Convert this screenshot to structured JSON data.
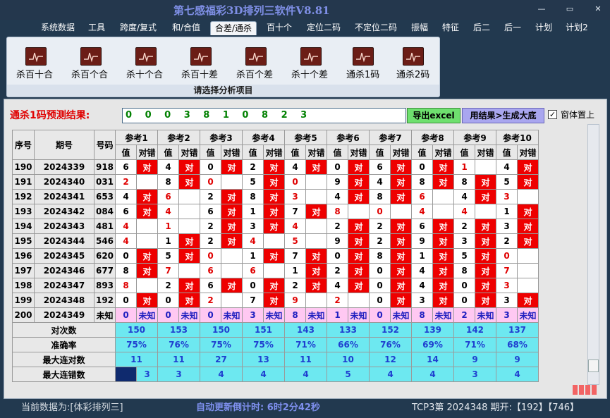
{
  "window": {
    "title": "第七感福彩3D排列三软件V8.81",
    "min": "—",
    "max": "▭",
    "close": "✕"
  },
  "menu": [
    "系统数据",
    "工具",
    "跨度/复式",
    "和/合值",
    "合差/通杀",
    "百十个",
    "定位二码",
    "不定位二码",
    "振幅",
    "特征",
    "后二",
    "后一",
    "计划",
    "计划2"
  ],
  "menu_active": "合差/通杀",
  "ribbon": {
    "items": [
      "杀百十合",
      "杀百个合",
      "杀十个合",
      "杀百十差",
      "杀百个差",
      "杀十个差",
      "通杀1码",
      "通杀2码"
    ],
    "footer": "请选择分析项目",
    "icon": "chart-icon"
  },
  "prediction": {
    "label": "通杀1码预测结果:",
    "value": "0 0 0 3 8 1 0 8 2 3",
    "excel_button": "导出excel",
    "gen_button": "用结果>生成大底",
    "topmost_label": "窗体置上",
    "topmost_checked": "✓"
  },
  "table": {
    "headers": {
      "seq": "序号",
      "period": "期号",
      "number": "号码",
      "val": "值",
      "check": "对错"
    },
    "refs": [
      "参考1",
      "参考2",
      "参考3",
      "参考4",
      "参考5",
      "参考6",
      "参考7",
      "参考8",
      "参考9",
      "参考10"
    ],
    "rows": [
      {
        "seq": "190",
        "period": "2024339",
        "number": "918",
        "cells": [
          [
            "6",
            ""
          ],
          [
            "4",
            ""
          ],
          [
            "0",
            ""
          ],
          [
            "2",
            ""
          ],
          [
            "4",
            ""
          ],
          [
            "0",
            ""
          ],
          [
            "6",
            ""
          ],
          [
            "0",
            ""
          ],
          [
            "1",
            ""
          ],
          [
            "4",
            ""
          ]
        ]
      },
      {
        "seq": "191",
        "period": "2024340",
        "number": "031",
        "cells": [
          [
            "2",
            ""
          ],
          [
            "8",
            ""
          ],
          [
            "0",
            ""
          ],
          [
            "5",
            ""
          ],
          [
            "0",
            ""
          ],
          [
            "9",
            ""
          ],
          [
            "4",
            ""
          ],
          [
            "8",
            ""
          ],
          [
            "8",
            ""
          ],
          [
            "5",
            ""
          ]
        ]
      },
      {
        "seq": "192",
        "period": "2024341",
        "number": "653",
        "cells": [
          [
            "4",
            ""
          ],
          [
            "6",
            ""
          ],
          [
            "2",
            ""
          ],
          [
            "8",
            ""
          ],
          [
            "3",
            ""
          ],
          [
            "4",
            ""
          ],
          [
            "8",
            ""
          ],
          [
            "6",
            ""
          ],
          [
            "4",
            ""
          ],
          [
            "3",
            ""
          ]
        ]
      },
      {
        "seq": "193",
        "period": "2024342",
        "number": "084",
        "cells": [
          [
            "6",
            ""
          ],
          [
            "4",
            ""
          ],
          [
            "6",
            ""
          ],
          [
            "1",
            ""
          ],
          [
            "7",
            ""
          ],
          [
            "8",
            ""
          ],
          [
            "0",
            ""
          ],
          [
            "4",
            ""
          ],
          [
            "4",
            ""
          ],
          [
            "1",
            ""
          ]
        ]
      },
      {
        "seq": "194",
        "period": "2024343",
        "number": "481",
        "cells": [
          [
            "4",
            ""
          ],
          [
            "1",
            ""
          ],
          [
            "2",
            ""
          ],
          [
            "3",
            ""
          ],
          [
            "4",
            ""
          ],
          [
            "2",
            ""
          ],
          [
            "2",
            ""
          ],
          [
            "6",
            ""
          ],
          [
            "2",
            ""
          ],
          [
            "3",
            ""
          ]
        ]
      },
      {
        "seq": "195",
        "period": "2024344",
        "number": "546",
        "cells": [
          [
            "4",
            ""
          ],
          [
            "1",
            ""
          ],
          [
            "2",
            ""
          ],
          [
            "4",
            ""
          ],
          [
            "5",
            ""
          ],
          [
            "9",
            ""
          ],
          [
            "2",
            ""
          ],
          [
            "9",
            ""
          ],
          [
            "3",
            ""
          ],
          [
            "2",
            ""
          ]
        ]
      },
      {
        "seq": "196",
        "period": "2024345",
        "number": "620",
        "cells": [
          [
            "0",
            ""
          ],
          [
            "5",
            ""
          ],
          [
            "0",
            ""
          ],
          [
            "1",
            ""
          ],
          [
            "7",
            ""
          ],
          [
            "0",
            ""
          ],
          [
            "8",
            ""
          ],
          [
            "1",
            ""
          ],
          [
            "5",
            ""
          ],
          [
            "0",
            ""
          ]
        ]
      },
      {
        "seq": "197",
        "period": "2024346",
        "number": "677",
        "cells": [
          [
            "8",
            ""
          ],
          [
            "7",
            ""
          ],
          [
            "6",
            ""
          ],
          [
            "6",
            ""
          ],
          [
            "1",
            ""
          ],
          [
            "2",
            ""
          ],
          [
            "0",
            ""
          ],
          [
            "4",
            ""
          ],
          [
            "8",
            ""
          ],
          [
            "7",
            ""
          ]
        ]
      },
      {
        "seq": "198",
        "period": "2024347",
        "number": "893",
        "cells": [
          [
            "8",
            ""
          ],
          [
            "2",
            ""
          ],
          [
            "6",
            ""
          ],
          [
            "0",
            ""
          ],
          [
            "2",
            ""
          ],
          [
            "4",
            ""
          ],
          [
            "0",
            ""
          ],
          [
            "4",
            ""
          ],
          [
            "0",
            ""
          ],
          [
            "3",
            ""
          ]
        ]
      },
      {
        "seq": "199",
        "period": "2024348",
        "number": "192",
        "cells": [
          [
            "0",
            ""
          ],
          [
            "0",
            ""
          ],
          [
            "2",
            ""
          ],
          [
            "7",
            ""
          ],
          [
            "9",
            ""
          ],
          [
            "2",
            ""
          ],
          [
            "0",
            ""
          ],
          [
            "3",
            ""
          ],
          [
            "0",
            ""
          ],
          [
            "3",
            ""
          ]
        ]
      }
    ],
    "hit_label": "对",
    "pending": {
      "seq": "200",
      "period": "2024349",
      "number": "未知",
      "values": [
        "0",
        "0",
        "0",
        "3",
        "8",
        "1",
        "0",
        "8",
        "2",
        "3"
      ],
      "label": "未知"
    },
    "stats": [
      {
        "label": "对次数",
        "values": [
          "150",
          "153",
          "150",
          "151",
          "143",
          "133",
          "152",
          "139",
          "142",
          "137"
        ]
      },
      {
        "label": "准确率",
        "values": [
          "75%",
          "76%",
          "75%",
          "75%",
          "71%",
          "66%",
          "76%",
          "69%",
          "71%",
          "68%"
        ]
      },
      {
        "label": "最大连对数",
        "values": [
          "11",
          "11",
          "27",
          "13",
          "11",
          "10",
          "12",
          "14",
          "9",
          "9"
        ]
      },
      {
        "label": "最大连错数",
        "values": [
          "3",
          "3",
          "4",
          "4",
          "4",
          "5",
          "4",
          "4",
          "3",
          "4"
        ]
      }
    ]
  },
  "status": {
    "left": "当前数据为:[体彩排列三]",
    "mid": "自动更新倒计时: 6时2分42秒",
    "right": "TCP3第 2024348 期开:【192】【746】"
  }
}
